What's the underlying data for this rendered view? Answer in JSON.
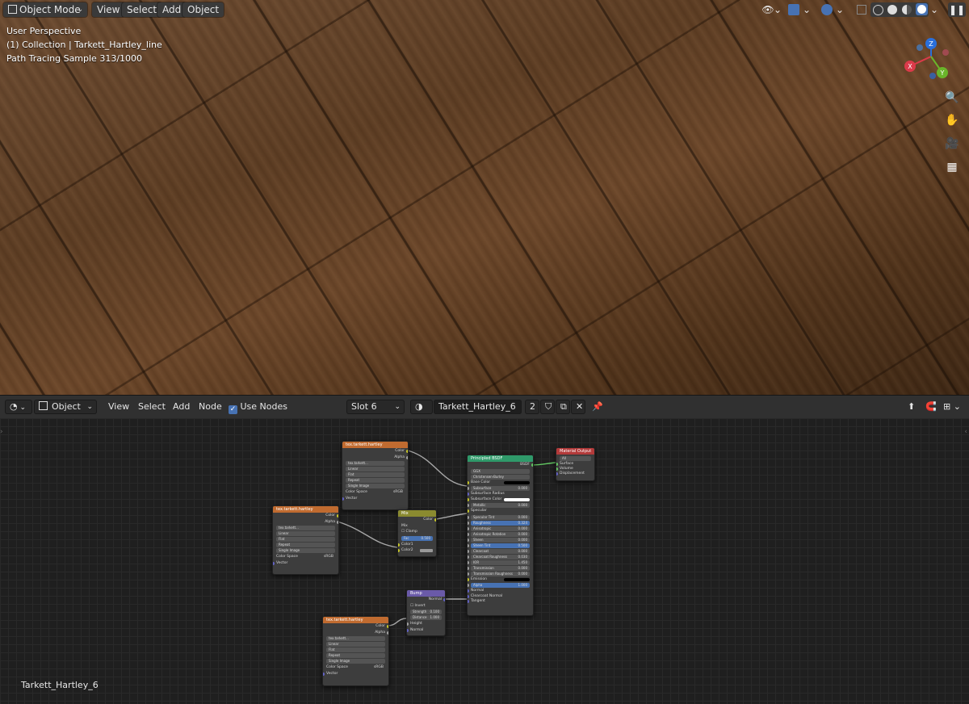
{
  "viewport": {
    "mode_label": "Object Mode",
    "menus": [
      "View",
      "Select",
      "Add",
      "Object"
    ],
    "overlay_lines": [
      "User Perspective",
      "(1) Collection | Tarkett_Hartley_line",
      "Path Tracing Sample 313/1000"
    ],
    "gizmo_axes": {
      "x": "X",
      "y": "Y",
      "z": "Z"
    }
  },
  "node_editor": {
    "editor_type_label": "Object",
    "menus": [
      "View",
      "Select",
      "Add",
      "Node"
    ],
    "use_nodes_label": "Use Nodes",
    "use_nodes_checked": true,
    "slot_label": "Slot 6",
    "material_name": "Tarkett_Hartley_6",
    "user_count": "2",
    "footer_material": "Tarkett_Hartley_6"
  },
  "nodes": {
    "tex_bump": {
      "title": "tex.tarkett.hartley",
      "outputs": [
        "Color",
        "Alpha"
      ],
      "image": "tex.tarkett...",
      "fields": [
        "Linear",
        "Flat",
        "Repeat",
        "Single Image"
      ],
      "color_space_label": "Color Space",
      "color_space": "sRGB",
      "vector": "Vector"
    },
    "tex_base": {
      "title": "tex.tarkett.hartley",
      "outputs": [
        "Color",
        "Alpha"
      ],
      "image": "tex.tarkett...",
      "fields": [
        "Linear",
        "Flat",
        "Repeat",
        "Single Image"
      ],
      "color_space_label": "Color Space",
      "color_space": "sRGB",
      "vector": "Vector"
    },
    "tex_normal": {
      "title": "tex.tarkett.hartley",
      "outputs": [
        "Color",
        "Alpha"
      ],
      "image": "tex.tarkett...",
      "fields": [
        "Linear",
        "Flat",
        "Repeat",
        "Single Image"
      ],
      "color_space_label": "Color Space",
      "color_space": "sRGB",
      "vector": "Vector"
    },
    "mix": {
      "title": "Mix",
      "output": "Color",
      "blend": "Mix",
      "clamp": "Clamp",
      "fac_label": "Fac",
      "fac": "0.500",
      "color1": "Color1",
      "color2": "Color2"
    },
    "bump": {
      "title": "Bump",
      "output": "Normal",
      "invert": "Invert",
      "strength_label": "Strength",
      "strength": "0.100",
      "distance_label": "Distance",
      "distance": "1.000",
      "height": "Height",
      "normal": "Normal"
    },
    "bsdf": {
      "title": "Principled BSDF",
      "output": "BSDF",
      "distribution": "GGX",
      "subsurface_method": "Christensen-Burley",
      "rows": [
        {
          "label": "Base Color",
          "value": ""
        },
        {
          "label": "Subsurface",
          "value": "0.000"
        },
        {
          "label": "Subsurface Radius",
          "value": ""
        },
        {
          "label": "Subsurface Color",
          "value": ""
        },
        {
          "label": "Metallic",
          "value": "0.000"
        },
        {
          "label": "Specular",
          "value": ""
        },
        {
          "label": "Specular Tint",
          "value": "0.000"
        },
        {
          "label": "Roughness",
          "value": "0.324"
        },
        {
          "label": "Anisotropic",
          "value": "0.000"
        },
        {
          "label": "Anisotropic Rotation",
          "value": "0.000"
        },
        {
          "label": "Sheen",
          "value": "0.000"
        },
        {
          "label": "Sheen Tint",
          "value": "0.500"
        },
        {
          "label": "Clearcoat",
          "value": "0.000"
        },
        {
          "label": "Clearcoat Roughness",
          "value": "0.030"
        },
        {
          "label": "IOR",
          "value": "1.450"
        },
        {
          "label": "Transmission",
          "value": "0.000"
        },
        {
          "label": "Transmission Roughness",
          "value": "0.000"
        },
        {
          "label": "Emission",
          "value": ""
        },
        {
          "label": "Alpha",
          "value": "1.000"
        },
        {
          "label": "Normal",
          "value": ""
        },
        {
          "label": "Clearcoat Normal",
          "value": ""
        },
        {
          "label": "Tangent",
          "value": ""
        }
      ]
    },
    "output": {
      "title": "Material Output",
      "target": "All",
      "inputs": [
        "Surface",
        "Volume",
        "Displacement"
      ]
    }
  }
}
